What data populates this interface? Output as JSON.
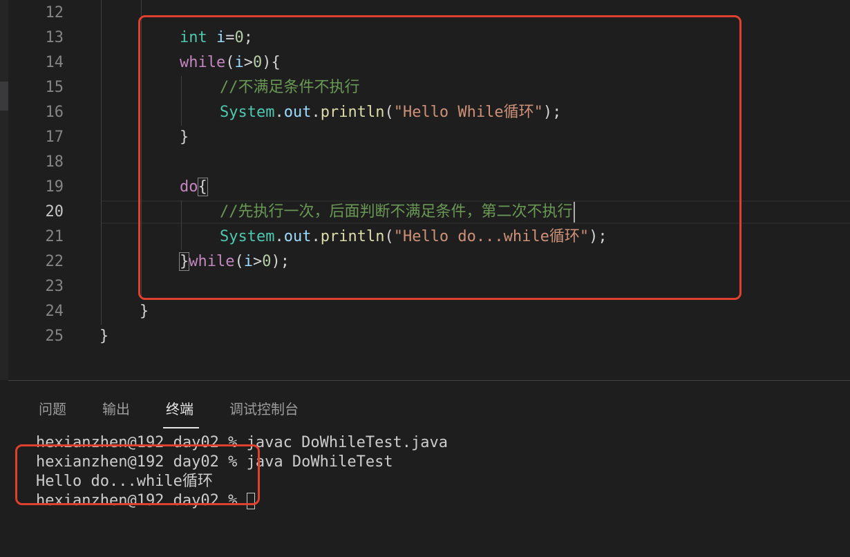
{
  "editor": {
    "line_numbers": [
      "12",
      "13",
      "14",
      "15",
      "16",
      "17",
      "18",
      "19",
      "20",
      "21",
      "22",
      "23",
      "24",
      "25"
    ],
    "active_line": "20",
    "code": {
      "l13": {
        "type": "int",
        "var": "i",
        "op": "=",
        "num": "0",
        "end": ";"
      },
      "l14": {
        "kw": "while",
        "open": "(",
        "var": "i",
        "op": ">",
        "num": "0",
        "close": "){"
      },
      "l15": {
        "comment": "//不满足条件不执行"
      },
      "l16": {
        "cls": "System",
        "dot1": ".",
        "field": "out",
        "dot2": ".",
        "fn": "println",
        "open": "(",
        "str": "\"Hello While循环\"",
        "close": ");"
      },
      "l17": {
        "brace": "}"
      },
      "l19": {
        "kw": "do",
        "brace": "{"
      },
      "l20": {
        "comment": "//先执行一次，后面判断不满足条件，第二次不执行"
      },
      "l21": {
        "cls": "System",
        "dot1": ".",
        "field": "out",
        "dot2": ".",
        "fn": "println",
        "open": "(",
        "str": "\"Hello do...while循环\"",
        "close": ");"
      },
      "l22": {
        "brace": "}",
        "kw": "while",
        "open": "(",
        "var": "i",
        "op": ">",
        "num": "0",
        "close": ");"
      },
      "l24": {
        "brace": "}"
      },
      "l25": {
        "brace": "}"
      }
    }
  },
  "panel": {
    "tabs": [
      {
        "label": "问题"
      },
      {
        "label": "输出"
      },
      {
        "label": "终端"
      },
      {
        "label": "调试控制台"
      }
    ],
    "active_tab": "终端",
    "terminal": {
      "lines": [
        "hexianzhen@192 day02 % javac DoWhileTest.java",
        "hexianzhen@192 day02 % java DoWhileTest",
        "Hello do...while循环",
        "hexianzhen@192 day02 % "
      ]
    }
  },
  "colors": {
    "background": "#1e1e1e",
    "highlight_box": "#e0412e",
    "keyword_type": "#4ec9b0",
    "keyword_control": "#c586c0",
    "comment": "#6a9955",
    "string": "#ce9178",
    "function": "#dcdcaa",
    "variable": "#9cdcfe",
    "number": "#b5cea8"
  }
}
